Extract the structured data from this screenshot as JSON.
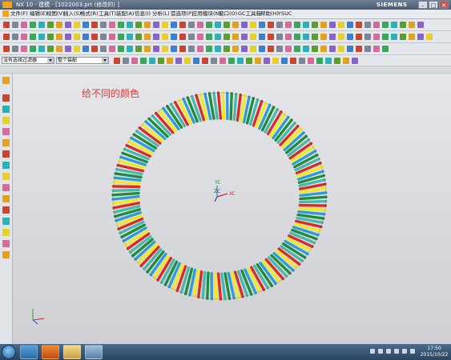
{
  "window": {
    "title": "NX 10 - 建模 - [1022003.prt (修改的) ]",
    "brand": "SIEMENS",
    "controls": [
      "–",
      "□",
      "✕"
    ]
  },
  "menu": [
    "文件(F)",
    "编辑(E)",
    "视图(V)",
    "插入(S)",
    "格式(R)",
    "工具(T)",
    "装配(A)",
    "信息(I)",
    "分析(L)",
    "首选项(P)",
    "应用模块(N)",
    "窗口(O)",
    "GC工具箱",
    "帮助(H)",
    "YSUC"
  ],
  "selection_bar": {
    "filter": "没有选择过滤器",
    "scope": "整个装配"
  },
  "viewport": {
    "annotation": "给不同的颜色",
    "annotation_color": "#e03a3a",
    "triad": {
      "y": "YC",
      "z": "ZC",
      "x": "XC"
    },
    "spring_colors": [
      "#d92b22",
      "#f2ea1e",
      "#2d9bd8",
      "#1e8c3a",
      "#46b8b0"
    ]
  },
  "taskbar": {
    "time": "17:50",
    "date": "2015/10/22"
  },
  "icons": {
    "toolbar_row1": "toolbar-icons-row-1",
    "toolbar_row2": "toolbar-icons-row-2",
    "toolbar_row3": "toolbar-icons-row-3",
    "resource_bar": "resource-bar-icons"
  }
}
